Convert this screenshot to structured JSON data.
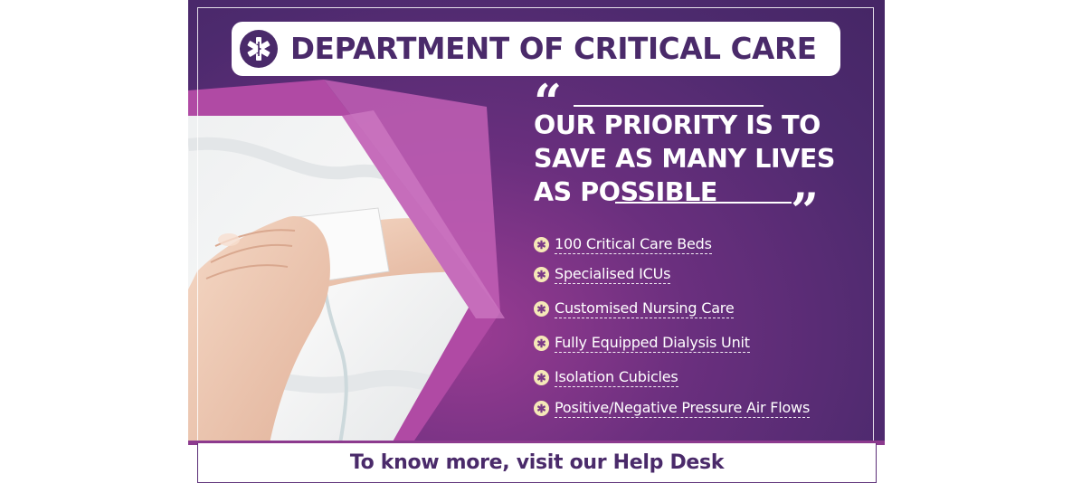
{
  "header": {
    "logo_icon": "star-of-life-icon",
    "title": "DEPARTMENT OF CRITICAL CARE"
  },
  "quote": {
    "text": "OUR PRIORITY IS TO\nSAVE AS MANY LIVES\nAS POSSIBLE",
    "open_mark": "“",
    "close_mark": "”"
  },
  "features": [
    {
      "icon": "star-of-life-icon",
      "label": "100 Critical Care Beds"
    },
    {
      "icon": "star-of-life-icon",
      "label": "Specialised ICUs"
    },
    {
      "icon": "star-of-life-icon",
      "label": "Customised Nursing Care"
    },
    {
      "icon": "star-of-life-icon",
      "label": "Fully Equipped Dialysis Unit"
    },
    {
      "icon": "star-of-life-icon",
      "label": "Isolation Cubicles"
    },
    {
      "icon": "star-of-life-icon",
      "label": "Positive/Negative Pressure Air Flows"
    }
  ],
  "footer": {
    "text": "To know more, visit our Help Desk"
  },
  "colors": {
    "brand_purple": "#4a2a6a",
    "accent_magenta": "#9a3c93",
    "icon_cream": "#f6e9b8"
  }
}
